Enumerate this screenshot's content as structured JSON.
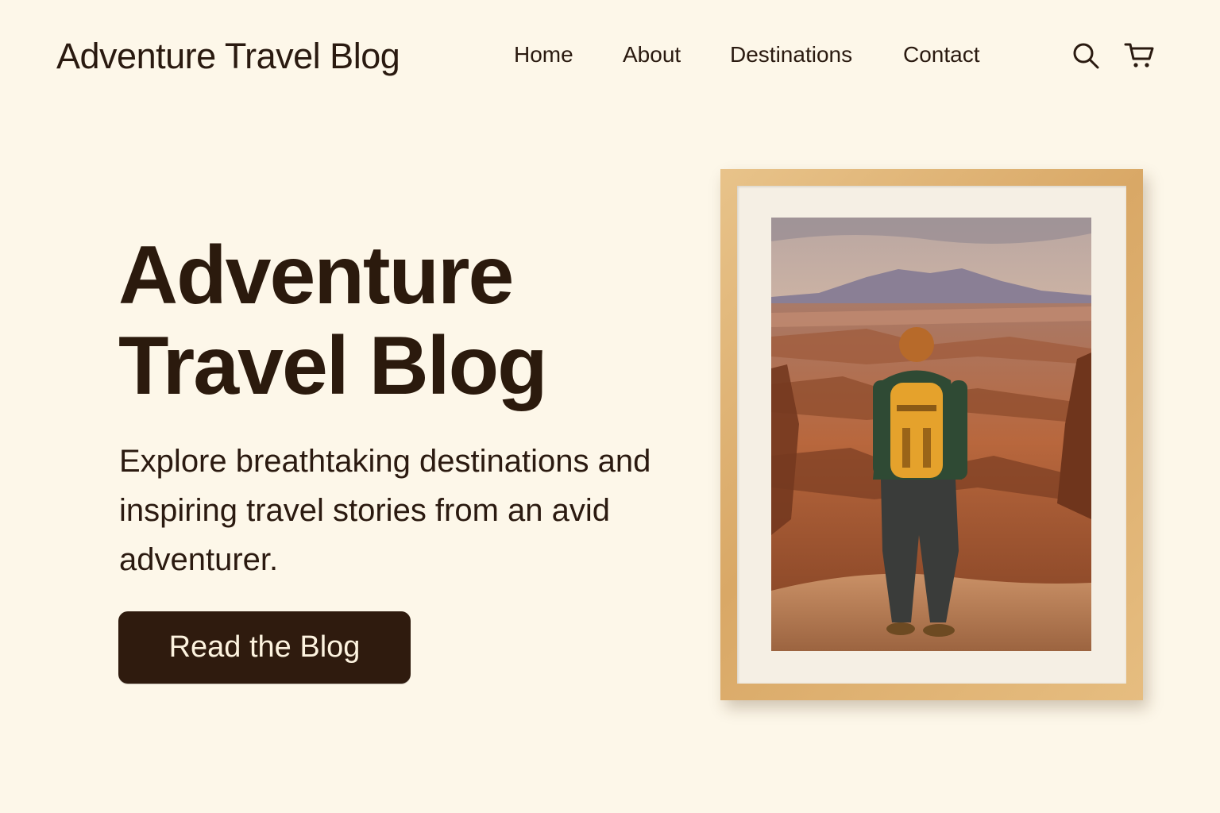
{
  "header": {
    "logo": "Adventure Travel Blog",
    "nav": [
      {
        "label": "Home"
      },
      {
        "label": "About"
      },
      {
        "label": "Destinations"
      },
      {
        "label": "Contact"
      }
    ],
    "icons": {
      "search": "search-icon",
      "cart": "cart-icon"
    }
  },
  "hero": {
    "title_line1": "Adventure",
    "title_line2": "Travel Blog",
    "subtitle": "Explore breathtaking destinations and inspiring travel stories from an avid adventurer.",
    "cta_label": "Read the Blog",
    "image_subject": "hiker with orange backpack overlooking desert canyon at sunset"
  },
  "colors": {
    "background": "#fdf7e9",
    "text": "#2b1a10",
    "button": "#2f1b0e",
    "button_text": "#fdf3df",
    "frame": "#d9a866"
  }
}
